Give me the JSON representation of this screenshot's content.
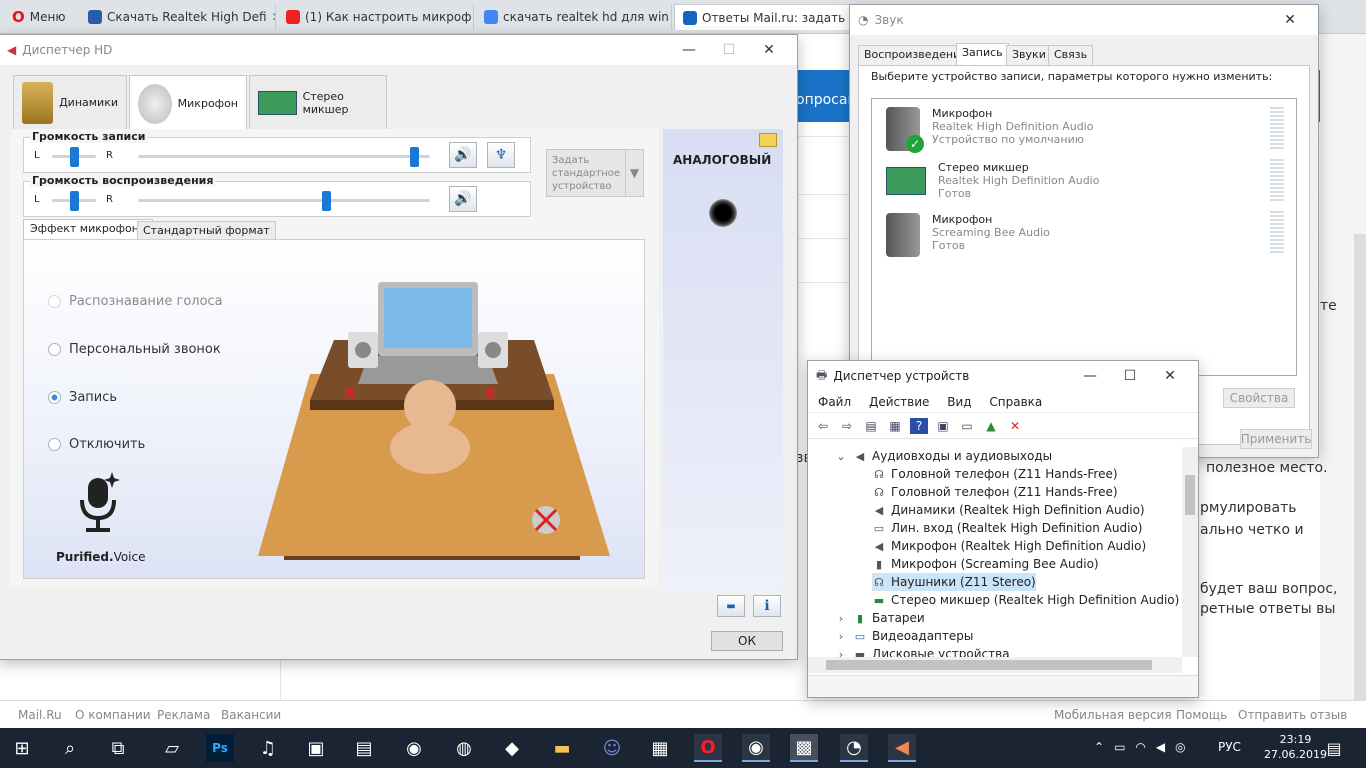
{
  "browser": {
    "menu_label": "Меню",
    "tabs": [
      {
        "title": "Скачать Realtek High Defi",
        "color": "#2a5ba8"
      },
      {
        "title": "(1) Как настроить микроф",
        "color": "#e22"
      },
      {
        "title": "скачать realtek hd для win",
        "color": "#4285f4"
      },
      {
        "title": "Ответы Mail.ru: задать воп",
        "color": "#1565c0"
      }
    ]
  },
  "bg_page": {
    "texts": [
      "опросам",
      "те",
      "полезное место.",
      "рмулировать",
      "ально четко и",
      "будет ваш вопрос,",
      "ретные ответы вы",
      "зв",
      "на"
    ],
    "footer_left": [
      "Mail.Ru",
      "О компании",
      "Реклама",
      "Вакансии"
    ],
    "footer_right": [
      "Мобильная версия",
      "Помощь",
      "Отправить отзыв"
    ]
  },
  "hd": {
    "title": "Диспетчер HD",
    "tabs": [
      "Динамики",
      "Микрофон",
      "Стерео микшер"
    ],
    "rec_volume_label": "Громкость записи",
    "play_volume_label": "Громкость воспроизведения",
    "lr_left": "L",
    "lr_right": "R",
    "set_default_lines": [
      "Задать",
      "стандартное",
      "устройство"
    ],
    "analog_label": "АНАЛОГОВЫЙ",
    "subtabs": [
      "Эффект микрофона",
      "Стандартный формат"
    ],
    "radios": [
      {
        "label": "Распознавание голоса",
        "state": "disabled"
      },
      {
        "label": "Персональный звонок",
        "state": "normal"
      },
      {
        "label": "Запись",
        "state": "selected"
      },
      {
        "label": "Отключить",
        "state": "normal"
      }
    ],
    "brand_bold": "Purified.",
    "brand_light": "Voice",
    "ok_label": "ОК",
    "rec_level": 0.96,
    "play_level": 0.65
  },
  "sound": {
    "title": "Звук",
    "tabs": [
      "Воспроизведение",
      "Запись",
      "Звуки",
      "Связь"
    ],
    "instruction": "Выберите устройство записи, параметры которого нужно изменить:",
    "devices": [
      {
        "name": "Микрофон",
        "driver": "Realtek High Definition Audio",
        "status": "Устройство по умолчанию"
      },
      {
        "name": "Стерео микшер",
        "driver": "Realtek High Definition Audio",
        "status": "Готов"
      },
      {
        "name": "Микрофон",
        "driver": "Screaming Bee Audio",
        "status": "Готов"
      }
    ],
    "props_label": "Свойства",
    "apply_label": "Применить"
  },
  "devmgr": {
    "title": "Диспетчер устройств",
    "menu": [
      "Файл",
      "Действие",
      "Вид",
      "Справка"
    ],
    "category": "Аудиовходы и аудиовыходы",
    "items": [
      "Головной телефон (Z11 Hands-Free)",
      "Головной телефон (Z11 Hands-Free)",
      "Динамики (Realtek High Definition Audio)",
      "Лин. вход (Realtek High Definition Audio)",
      "Микрофон (Realtek High Definition Audio)",
      "Микрофон (Screaming Bee Audio)",
      "Наушники (Z11 Stereo)",
      "Стерео микшер (Realtek High Definition Audio)"
    ],
    "other_categories": [
      "Батареи",
      "Видеоадаптеры",
      "Дисковые устройства"
    ]
  },
  "taskbar": {
    "lang": "РУС",
    "time": "23:19",
    "date": "27.06.2019"
  }
}
